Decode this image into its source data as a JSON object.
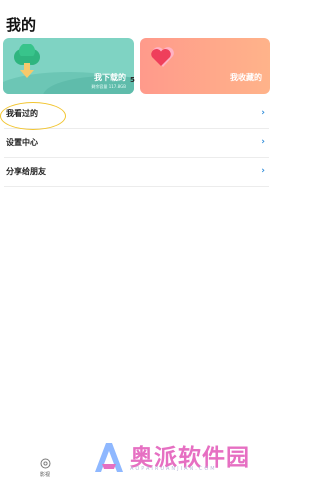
{
  "page": {
    "title": "我的"
  },
  "cards": {
    "downloads": {
      "label": "我下载的",
      "sub": "剩余容量 117.8GB",
      "edge_digit": "5"
    },
    "favorites": {
      "label": "我收藏的"
    }
  },
  "menu": {
    "items": [
      {
        "label": "我看过的"
      },
      {
        "label": "设置中心"
      },
      {
        "label": "分享给朋友"
      }
    ]
  },
  "bottom_nav": {
    "tab_label": "影视"
  },
  "watermark": {
    "text": "奥派软件园",
    "sub": "AOPAIRUANJIAN.COM"
  },
  "colors": {
    "accent": "#2b8ad9",
    "download_card": "#7fd3c3",
    "favorite_card": "#ff9a8b",
    "highlight": "#f2c530"
  },
  "icons": {
    "download": "download-tree-icon",
    "favorite": "heart-icon",
    "chevron": "chevron-right-icon",
    "nav": "film-reel-icon"
  }
}
